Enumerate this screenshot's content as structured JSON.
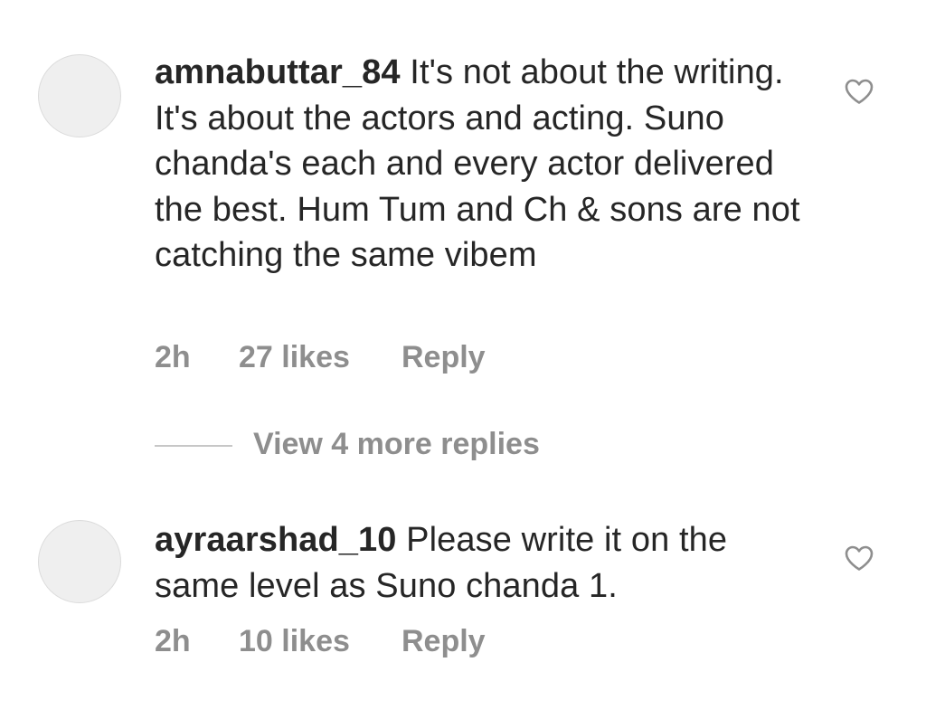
{
  "comments": [
    {
      "username": "amnabuttar_84",
      "text": " It's not about the writing. It's about the actors and acting. Suno chanda's each and every actor delivered the best. Hum Tum and Ch & sons are not catching the same vibem",
      "time": "2h",
      "likes": "27 likes",
      "reply_label": "Reply",
      "avatar_icon": "default-avatar",
      "like_icon": "heart-outline-icon"
    },
    {
      "username": "ayraarshad_10",
      "text": " Please write it on the same level as Suno chanda 1.",
      "time": "2h",
      "likes": "10 likes",
      "reply_label": "Reply",
      "avatar_icon": "default-avatar",
      "like_icon": "heart-outline-icon"
    }
  ],
  "view_replies": {
    "label": "View 4 more replies"
  },
  "colors": {
    "text": "#262626",
    "secondary": "#8e8e8e",
    "avatar_fill": "#efefef",
    "divider": "#c7c7c7"
  }
}
